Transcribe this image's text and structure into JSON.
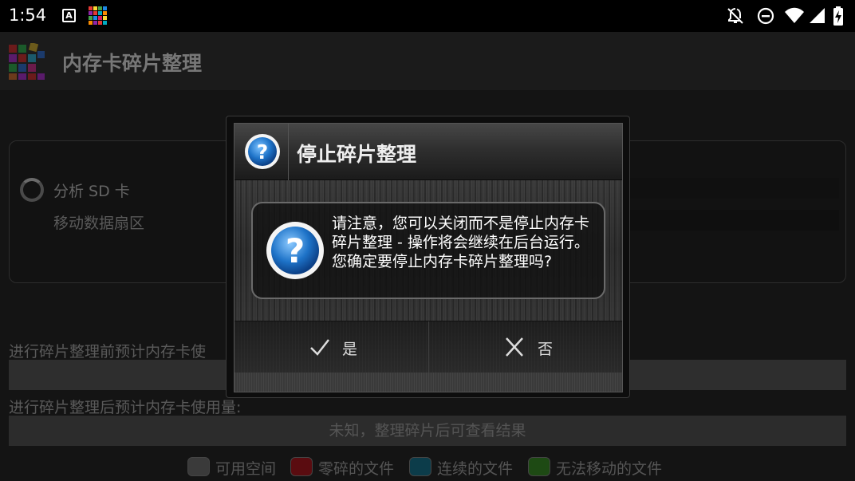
{
  "status_bar": {
    "time": "1:54",
    "notification_icons": [
      "font-a-icon",
      "color-grid-icon"
    ],
    "system_icons": [
      "notifications-off-icon",
      "do-not-disturb-icon",
      "wifi-icon",
      "cell-signal-icon",
      "battery-charging-icon"
    ]
  },
  "app": {
    "title": "内存卡碎片整理",
    "analyze": {
      "title": "分析 SD 卡",
      "subtitle": "移动数据扇区"
    },
    "usage_before_label": "进行碎片整理前预计内存卡使",
    "usage_after_label": "进行碎片整理后预计内存卡使用量:",
    "usage_after_value": "未知，整理碎片后可查看结果",
    "legend": [
      {
        "label": "可用空间",
        "color": "#3a3a3a"
      },
      {
        "label": "零碎的文件",
        "color": "#5a0c10"
      },
      {
        "label": "连续的文件",
        "color": "#0c3c4a"
      },
      {
        "label": "无法移动的文件",
        "color": "#1e4a14"
      }
    ]
  },
  "dialog": {
    "title": "停止碎片整理",
    "message": "请注意，您可以关闭而不是停止内存卡碎片整理 - 操作将会继续在后台运行。您确定要停止内存卡碎片整理吗?",
    "yes_label": "是",
    "no_label": "否"
  },
  "colors": {
    "dialog_icon_blue": "#1e73c8",
    "background": "#000000"
  }
}
